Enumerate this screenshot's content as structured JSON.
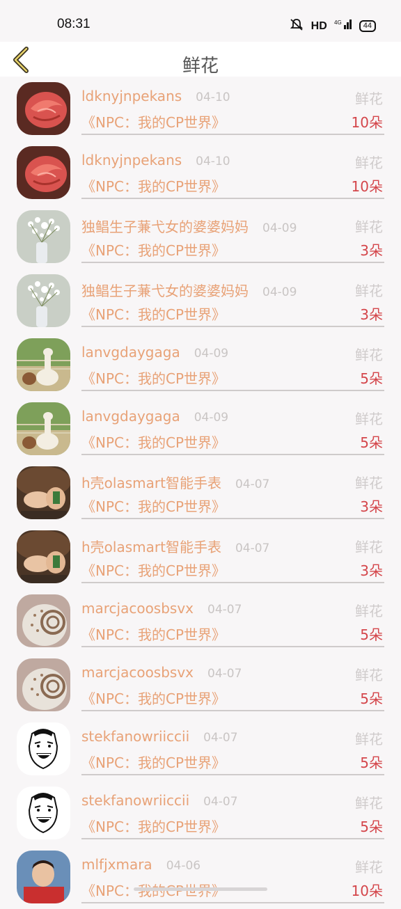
{
  "status": {
    "time": "08:31",
    "network": "HD",
    "signal": "4G",
    "battery": "44"
  },
  "header": {
    "title": "鲜花"
  },
  "gift_label": "鲜花",
  "rows": [
    {
      "name": "ldknyjnpekans",
      "date": "04-10",
      "book": "《NPC：我的CP世界》",
      "amount": "10朵",
      "avatar": "rose"
    },
    {
      "name": "ldknyjnpekans",
      "date": "04-10",
      "book": "《NPC：我的CP世界》",
      "amount": "10朵",
      "avatar": "rose"
    },
    {
      "name": "独鲳生子蒹弋女的婆婆妈妈",
      "date": "04-09",
      "book": "《NPC：我的CP世界》",
      "amount": "3朵",
      "avatar": "babys-breath"
    },
    {
      "name": "独鲳生子蒹弋女的婆婆妈妈",
      "date": "04-09",
      "book": "《NPC：我的CP世界》",
      "amount": "3朵",
      "avatar": "babys-breath"
    },
    {
      "name": "lanvgdaygaga",
      "date": "04-09",
      "book": "《NPC：我的CP世界》",
      "amount": "5朵",
      "avatar": "alpaca"
    },
    {
      "name": "lanvgdaygaga",
      "date": "04-09",
      "book": "《NPC：我的CP世界》",
      "amount": "5朵",
      "avatar": "alpaca"
    },
    {
      "name": "h壳olasmart智能手表",
      "date": "04-07",
      "book": "《NPC：我的CP世界》",
      "amount": "3朵",
      "avatar": "hands"
    },
    {
      "name": "h壳olasmart智能手表",
      "date": "04-07",
      "book": "《NPC：我的CP世界》",
      "amount": "3朵",
      "avatar": "hands"
    },
    {
      "name": "marcjacoosbsvx",
      "date": "04-07",
      "book": "《NPC：我的CP世界》",
      "amount": "5朵",
      "avatar": "shell"
    },
    {
      "name": "marcjacoosbsvx",
      "date": "04-07",
      "book": "《NPC：我的CP世界》",
      "amount": "5朵",
      "avatar": "shell"
    },
    {
      "name": "stekfanowriiccii",
      "date": "04-07",
      "book": "《NPC：我的CP世界》",
      "amount": "5朵",
      "avatar": "meme-face"
    },
    {
      "name": "stekfanowriiccii",
      "date": "04-07",
      "book": "《NPC：我的CP世界》",
      "amount": "5朵",
      "avatar": "meme-face"
    },
    {
      "name": "mlfjxmara",
      "date": "04-06",
      "book": "《NPC：我的CP世界》",
      "amount": "10朵",
      "avatar": "child"
    }
  ]
}
